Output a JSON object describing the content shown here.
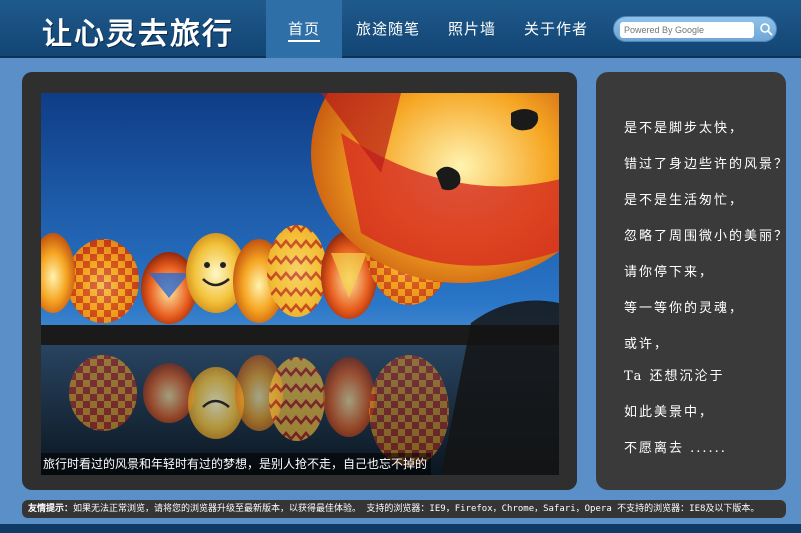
{
  "header": {
    "logo": "让心灵去旅行",
    "nav": [
      "首页",
      "旅途随笔",
      "照片墙",
      "关于作者"
    ],
    "search_placeholder": "Powered By Google"
  },
  "main": {
    "caption": "旅行时看过的风景和年轻时有过的梦想，是别人抢不走，自己也忘不掉的"
  },
  "poem": {
    "lines": [
      "是不是脚步太快，",
      "错过了身边些许的风景？",
      "是不是生活匆忙，",
      "忽略了周围微小的美丽？",
      "请你停下来，",
      "等一等你的灵魂，",
      "或许，",
      "Ta 还想沉沦于",
      "如此美景中，",
      "不愿离去 ......"
    ]
  },
  "footer": {
    "label": "友情提示：",
    "text": "如果无法正常浏览，请将您的浏览器升级至最新版本，以获得最佳体验。   支持的浏览器：IE9，Firefox，Chrome，Safari，Opera   不支持的浏览器：IE8及以下版本。"
  },
  "colors": {
    "page_bg": "#5b8fc7",
    "header_bg": "#124574",
    "nav_active": "#2f6fa8",
    "panel_bg": "#2f2f2f"
  },
  "icons": {
    "search": "magnifier-icon"
  }
}
